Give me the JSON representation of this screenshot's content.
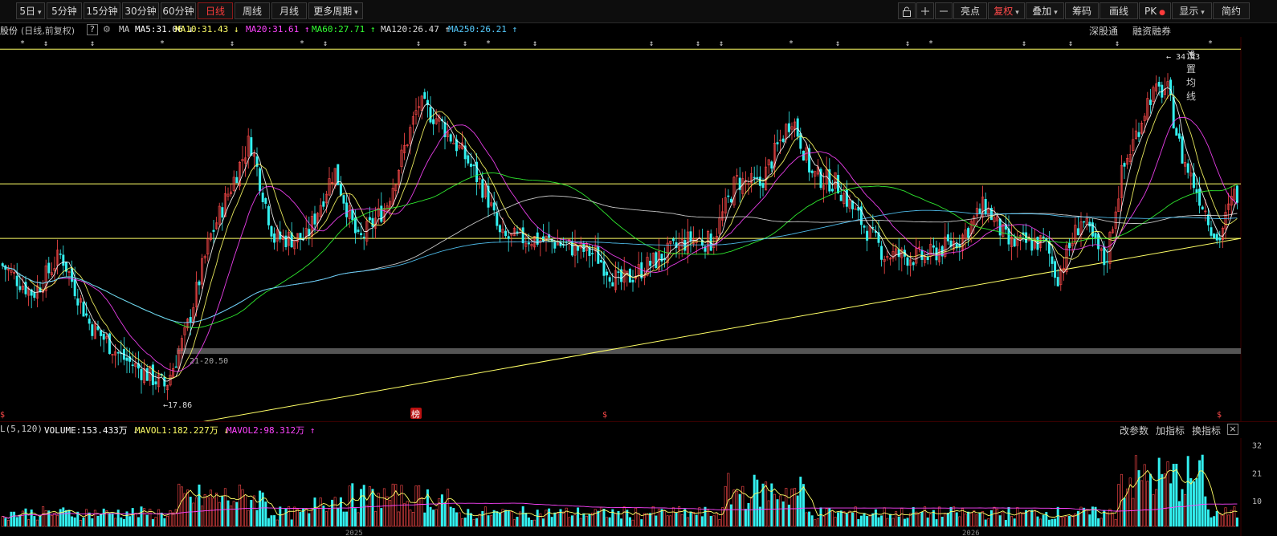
{
  "toolbar": {
    "periods": [
      "5日",
      "5分钟",
      "15分钟",
      "30分钟",
      "60分钟",
      "日线",
      "周线",
      "月线",
      "更多周期"
    ],
    "active_period": "日线",
    "right_buttons": [
      "亮点",
      "复权",
      "叠加",
      "筹码",
      "画线",
      "PK",
      "显示",
      "简约"
    ],
    "icons": [
      "lock-icon",
      "plus-icon",
      "minus-icon"
    ]
  },
  "ma_legend": {
    "stock": "股份",
    "mode": "(日线,前复权)",
    "help": "?",
    "ma_label": "MA",
    "items": [
      {
        "text": "MA5:31.06",
        "arrow": "↓",
        "color": "#ffffff"
      },
      {
        "text": "MA10:31.43",
        "arrow": "↓",
        "color": "#ffff66"
      },
      {
        "text": "MA20:31.61",
        "arrow": "↑",
        "color": "#ff44ff"
      },
      {
        "text": "MA60:27.71",
        "arrow": "↑",
        "color": "#33ff33"
      },
      {
        "text": "MA120:26.47",
        "arrow": "↑",
        "color": "#dddddd"
      },
      {
        "text": "MA250:26.21",
        "arrow": "↑",
        "color": "#55ccff"
      }
    ],
    "links": [
      "深股通",
      "融资融券",
      "设置均线"
    ]
  },
  "price_chart": {
    "high_label": "34.43",
    "low_label": "17.86",
    "range_label": "21-20.50",
    "bang_badge": "榜",
    "s_badge": "$",
    "ylim": [
      16.5,
      36.0
    ],
    "hlines": [
      35.38,
      28.56,
      25.8
    ],
    "trendline": [
      [
        250,
        16.5
      ],
      [
        1545,
        25.8
      ]
    ]
  },
  "volume": {
    "label": "L(5,120)",
    "items": [
      {
        "text": "VOLUME:153.433万",
        "arrow": "↓",
        "color": "#ffffff"
      },
      {
        "text": "MAVOL1:182.227万",
        "arrow": "↓",
        "color": "#ffff66"
      },
      {
        "text": "MAVOL2:98.312万",
        "arrow": "↑",
        "color": "#ff44ff"
      }
    ],
    "actions": [
      "改参数",
      "加指标",
      "换指标"
    ],
    "close": "×",
    "axis_ticks": [
      "32",
      "21",
      "10"
    ]
  },
  "x_ticks": [
    "2025",
    "2026"
  ],
  "colors": {
    "up": "#ff4a4a",
    "down": "#33f0f0",
    "bg": "#000000",
    "hline": "#ffff66"
  }
}
